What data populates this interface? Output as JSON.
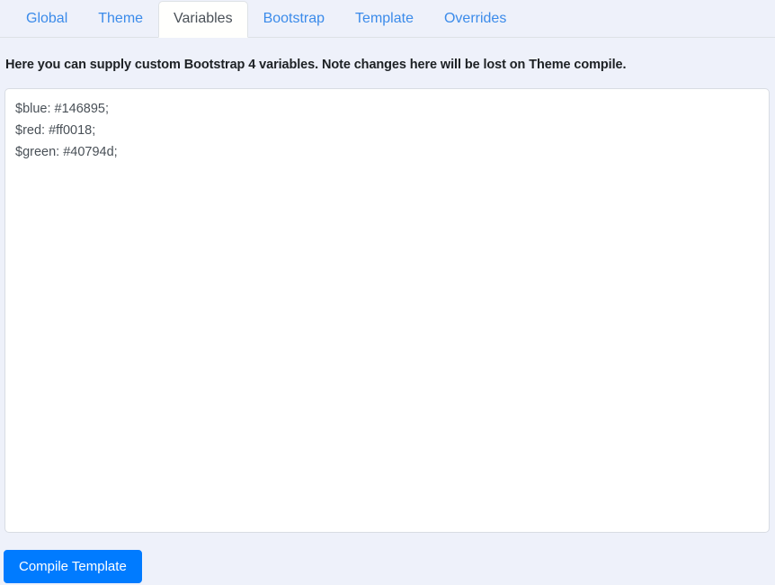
{
  "tabs": [
    {
      "label": "Global",
      "active": false
    },
    {
      "label": "Theme",
      "active": false
    },
    {
      "label": "Variables",
      "active": true
    },
    {
      "label": "Bootstrap",
      "active": false
    },
    {
      "label": "Template",
      "active": false
    },
    {
      "label": "Overrides",
      "active": false
    }
  ],
  "panel": {
    "description": "Here you can supply custom Bootstrap 4 variables. Note changes here will be lost on Theme compile.",
    "editor": {
      "value": "$blue: #146895;\n$red: #ff0018;\n$green: #40794d;",
      "placeholder": "",
      "lines": [
        "$blue: #146895;",
        "$red: #ff0018;",
        "$green: #40794d;"
      ],
      "variables": [
        {
          "name": "$blue",
          "value": "#146895"
        },
        {
          "name": "$red",
          "value": "#ff0018"
        },
        {
          "name": "$green",
          "value": "#40794d"
        }
      ]
    }
  },
  "actions": {
    "compile_label": "Compile Template"
  },
  "colors": {
    "page_background": "#eef1fa",
    "tab_link": "#3b8bea",
    "tab_active_text": "#495057",
    "tab_border": "#dee2e6",
    "heading_text": "#1d2124",
    "editor_background": "#ffffff",
    "editor_border": "#d8dce3",
    "editor_text": "#495057",
    "primary_button": "#007bff",
    "primary_button_text": "#ffffff"
  }
}
